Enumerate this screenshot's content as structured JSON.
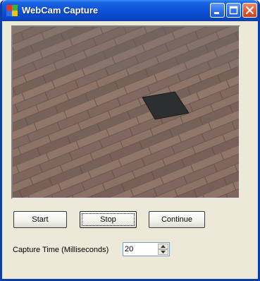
{
  "window": {
    "title": "WebCam Capture",
    "title_bar_color": "#0a4fd4",
    "close_button_color": "#e0542e"
  },
  "title_buttons": {
    "minimize_icon": "minimize-icon",
    "maximize_icon": "maximize-icon",
    "close_icon": "close-icon"
  },
  "preview": {
    "content": "webcam-feed-image"
  },
  "buttons": {
    "start_label": "Start",
    "stop_label": "Stop",
    "continue_label": "Continue"
  },
  "capture": {
    "label": "Capture Time (Milliseconds)",
    "value": "20"
  }
}
